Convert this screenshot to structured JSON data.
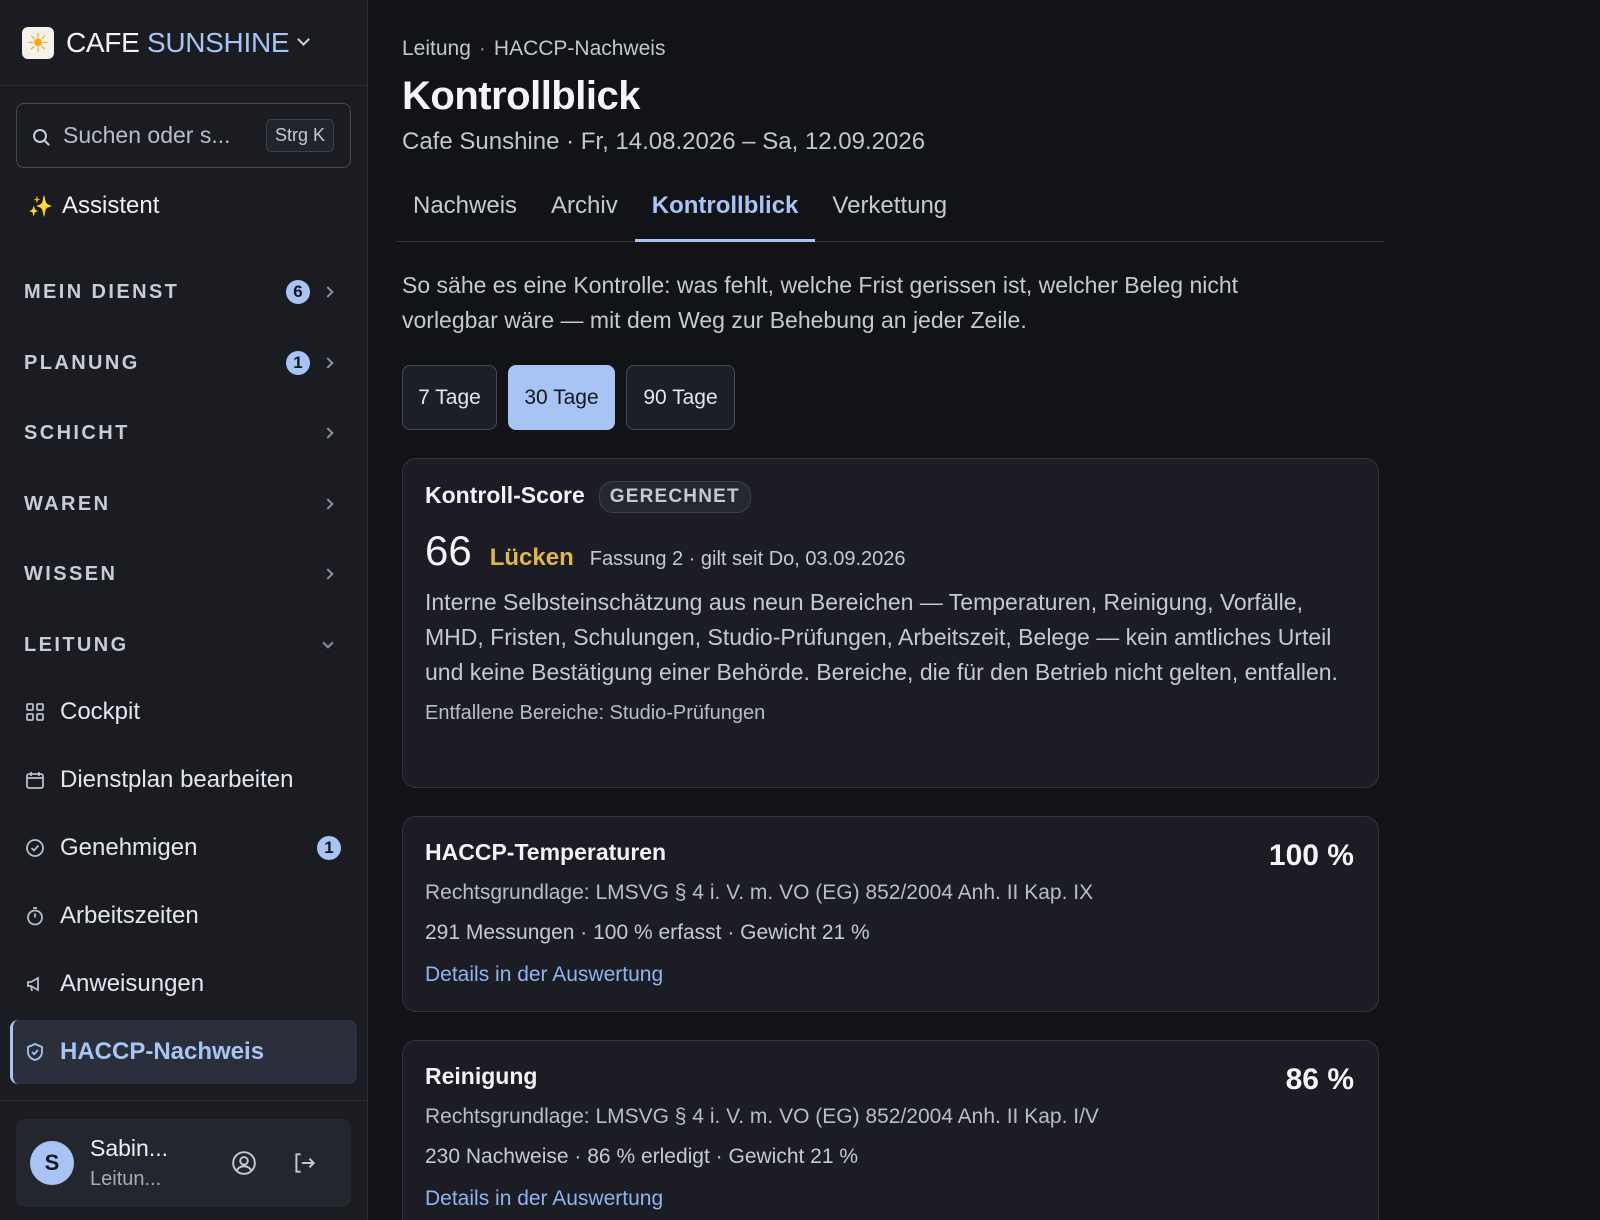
{
  "brand": {
    "name_part1": "CAFE",
    "name_part2": "SUNSHINE",
    "logo": "sun-icon"
  },
  "search": {
    "placeholder": "Suchen oder s...",
    "shortcut": "Strg K"
  },
  "assistant": {
    "label": "Assistent"
  },
  "sections": [
    {
      "label": "MEIN DIENST",
      "badge": "6"
    },
    {
      "label": "PLANUNG",
      "badge": "1"
    },
    {
      "label": "SCHICHT"
    },
    {
      "label": "WAREN"
    },
    {
      "label": "WISSEN"
    },
    {
      "label": "LEITUNG"
    }
  ],
  "leitung_items": [
    {
      "label": "Cockpit",
      "icon": "grid-icon"
    },
    {
      "label": "Dienstplan bearbeiten",
      "icon": "calendar-icon"
    },
    {
      "label": "Genehmigen",
      "icon": "check-badge-icon",
      "badge": "1"
    },
    {
      "label": "Arbeitszeiten",
      "icon": "stopwatch-icon"
    },
    {
      "label": "Anweisungen",
      "icon": "megaphone-icon"
    },
    {
      "label": "HACCP-Nachweis",
      "icon": "shield-icon",
      "active": true
    }
  ],
  "user": {
    "initial": "S",
    "name": "Sabin...",
    "role": "Leitun..."
  },
  "breadcrumb": {
    "parent": "Leitung",
    "sep": "·",
    "current": "HACCP-Nachweis"
  },
  "page": {
    "title": "Kontrollblick",
    "subtitle": "Cafe Sunshine · Fr, 14.08.2026 – Sa, 12.09.2026"
  },
  "tabs": [
    {
      "label": "Nachweis"
    },
    {
      "label": "Archiv"
    },
    {
      "label": "Kontrollblick",
      "active": true
    },
    {
      "label": "Verkettung"
    }
  ],
  "intro": "So sähe es eine Kontrolle: was fehlt, welche Frist gerissen ist, welcher Beleg nicht vorlegbar wäre — mit dem Weg zur Behebung an jeder Zeile.",
  "ranges": [
    {
      "label": "7 Tage"
    },
    {
      "label": "30 Tage",
      "active": true
    },
    {
      "label": "90 Tage"
    }
  ],
  "score_card": {
    "title": "Kontroll-Score",
    "pill": "GERECHNET",
    "score": "66",
    "status": "Lücken",
    "version": "Fassung 2 · gilt seit Do, 03.09.2026",
    "description": "Interne Selbsteinschätzung aus neun Bereichen — Temperaturen, Reinigung, Vorfälle, MHD, Fristen, Schulungen, Studio-Prüfungen, Arbeitszeit, Belege — kein amtliches Urteil und keine Bestätigung einer Behörde. Bereiche, die für den Betrieb nicht gelten, entfallen.",
    "excluded": "Entfallene Bereiche: Studio-Prüfungen",
    "colors": {
      "status": "#e0b84a",
      "accent": "#a8c4f5"
    }
  },
  "areas": [
    {
      "title": "HACCP-Temperaturen",
      "percent": "100 %",
      "legal": "Rechtsgrundlage: LMSVG § 4 i. V. m. VO (EG) 852/2004 Anh. II Kap. IX",
      "stats": "291 Messungen · 100 % erfasst · Gewicht 21 %",
      "link": "Details in der Auswertung"
    },
    {
      "title": "Reinigung",
      "percent": "86 %",
      "legal": "Rechtsgrundlage: LMSVG § 4 i. V. m. VO (EG) 852/2004 Anh. II Kap. I/V",
      "stats": "230 Nachweise · 86 % erledigt · Gewicht 21 %",
      "link": "Details in der Auswertung"
    }
  ]
}
